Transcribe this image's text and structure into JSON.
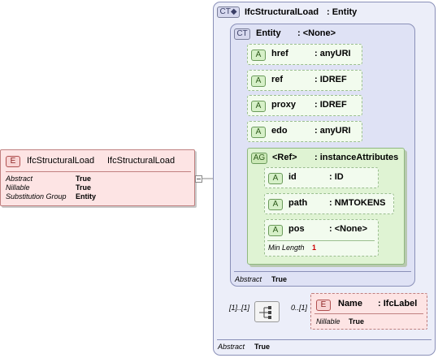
{
  "root_element": {
    "badge": "E",
    "name": "IfcStructuralLoad",
    "type": "IfcStructuralLoad",
    "props": [
      {
        "label": "Abstract",
        "value": "True"
      },
      {
        "label": "Nillable",
        "value": "True"
      },
      {
        "label": "Substitution Group",
        "value": "Entity"
      }
    ]
  },
  "complex_type": {
    "badge": "CT",
    "title": "IfcStructuralLoad",
    "title_type": ": Entity",
    "footer_label": "Abstract",
    "footer_value": "True"
  },
  "entity_type": {
    "badge": "CT",
    "name": "Entity",
    "type": ": <None>",
    "footer_label": "Abstract",
    "footer_value": "True"
  },
  "attributes": [
    {
      "badge": "A",
      "name": "href",
      "type": ": anyURI"
    },
    {
      "badge": "A",
      "name": "ref",
      "type": ": IDREF"
    },
    {
      "badge": "A",
      "name": "proxy",
      "type": ": IDREF"
    },
    {
      "badge": "A",
      "name": "edo",
      "type": ": anyURI"
    }
  ],
  "attribute_group": {
    "badge": "AG",
    "name": "<Ref>",
    "type": ": instanceAttributes",
    "attributes": [
      {
        "badge": "A",
        "name": "id",
        "type": ": ID"
      },
      {
        "badge": "A",
        "name": "path",
        "type": ": NMTOKENS"
      },
      {
        "badge": "A",
        "name": "pos",
        "type": ": <None>",
        "facet_label": "Min Length",
        "facet_value": "1"
      }
    ]
  },
  "sequence": {
    "left_cardinality": "[1]..[1]",
    "right_cardinality": "0..[1]"
  },
  "name_element": {
    "badge": "E",
    "name": "Name",
    "type": ": IfcLabel",
    "prop_label": "Nillable",
    "prop_value": "True"
  },
  "colors": {
    "element_fill": "#fde4e4",
    "element_border": "#c08080",
    "complex_fill": "#eceef9",
    "complex_border": "#8a90b8",
    "group_fill": "#dff3d3",
    "attr_fill": "#f2fbee",
    "facet_value": "#cc0000"
  }
}
